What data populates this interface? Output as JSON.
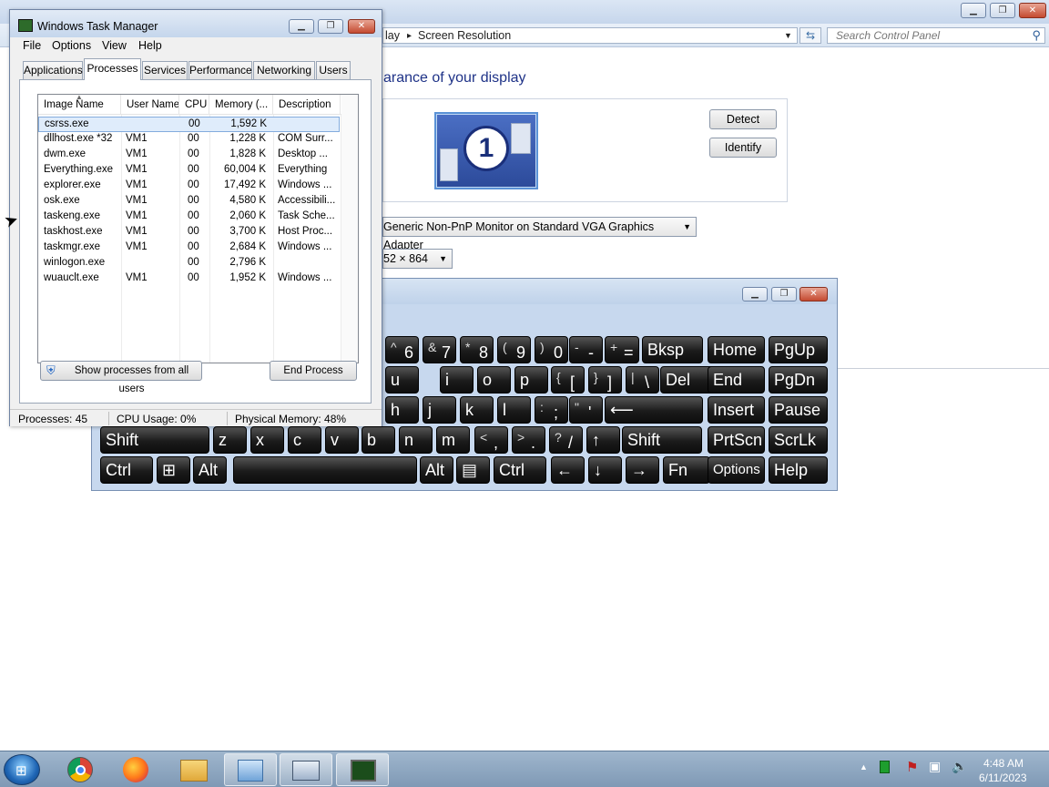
{
  "control_panel": {
    "breadcrumb": [
      "lay",
      "Screen Resolution"
    ],
    "breadcrumb_sep": "▸",
    "search_placeholder": "Search Control Panel",
    "heading": "arance of your display",
    "detect_label": "Detect",
    "identify_label": "Identify",
    "monitor_number": "1",
    "display_value": "Generic Non-PnP Monitor on Standard VGA Graphics Adapter",
    "resolution_value": "52 × 864"
  },
  "task_manager": {
    "title": "Windows Task Manager",
    "menu": [
      "File",
      "Options",
      "View",
      "Help"
    ],
    "tabs": [
      "Applications",
      "Processes",
      "Services",
      "Performance",
      "Networking",
      "Users"
    ],
    "active_tab": "Processes",
    "columns": [
      "Image Name",
      "User Name",
      "CPU",
      "Memory (...",
      "Description"
    ],
    "rows": [
      {
        "image": "csrss.exe",
        "user": "",
        "cpu": "00",
        "memory": "1,592 K",
        "description": ""
      },
      {
        "image": "dllhost.exe *32",
        "user": "VM1",
        "cpu": "00",
        "memory": "1,228 K",
        "description": "COM Surr..."
      },
      {
        "image": "dwm.exe",
        "user": "VM1",
        "cpu": "00",
        "memory": "1,828 K",
        "description": "Desktop ..."
      },
      {
        "image": "Everything.exe",
        "user": "VM1",
        "cpu": "00",
        "memory": "60,004 K",
        "description": "Everything"
      },
      {
        "image": "explorer.exe",
        "user": "VM1",
        "cpu": "00",
        "memory": "17,492 K",
        "description": "Windows ..."
      },
      {
        "image": "osk.exe",
        "user": "VM1",
        "cpu": "00",
        "memory": "4,580 K",
        "description": "Accessibili..."
      },
      {
        "image": "taskeng.exe",
        "user": "VM1",
        "cpu": "00",
        "memory": "2,060 K",
        "description": "Task Sche..."
      },
      {
        "image": "taskhost.exe",
        "user": "VM1",
        "cpu": "00",
        "memory": "3,700 K",
        "description": "Host Proc..."
      },
      {
        "image": "taskmgr.exe",
        "user": "VM1",
        "cpu": "00",
        "memory": "2,684 K",
        "description": "Windows ..."
      },
      {
        "image": "winlogon.exe",
        "user": "",
        "cpu": "00",
        "memory": "2,796 K",
        "description": ""
      },
      {
        "image": "wuauclt.exe",
        "user": "VM1",
        "cpu": "00",
        "memory": "1,952 K",
        "description": "Windows ..."
      }
    ],
    "show_all_label": "Show processes from all users",
    "end_process_label": "End Process",
    "status": {
      "processes": "Processes: 45",
      "cpu": "CPU Usage: 0%",
      "memory": "Physical Memory: 48%"
    }
  },
  "keyboard": {
    "rows": [
      [
        {
          "sup": "^",
          "main": "6"
        },
        {
          "sup": "&",
          "main": "7"
        },
        {
          "sup": "*",
          "main": "8"
        },
        {
          "sup": "(",
          "main": "9"
        },
        {
          "sup": ")",
          "main": "0"
        },
        {
          "sup": "-",
          "main": "-"
        },
        {
          "sup": "+",
          "main": "="
        },
        {
          "label": "Bksp"
        },
        {
          "label": "Home"
        },
        {
          "label": "PgUp"
        }
      ],
      [
        {
          "label": "u"
        },
        {
          "label": "i"
        },
        {
          "label": "o"
        },
        {
          "label": "p"
        },
        {
          "sup": "{",
          "main": "["
        },
        {
          "sup": "}",
          "main": "]"
        },
        {
          "sup": "|",
          "main": "\\"
        },
        {
          "label": "Del"
        },
        {
          "label": "End"
        },
        {
          "label": "PgDn"
        }
      ],
      [
        {
          "label": "h"
        },
        {
          "label": "j"
        },
        {
          "label": "k"
        },
        {
          "label": "l"
        },
        {
          "sup": ":",
          "main": ";"
        },
        {
          "sup": "\"",
          "main": "'"
        },
        {
          "label": "⟵"
        },
        {
          "label": "Insert"
        },
        {
          "label": "Pause"
        }
      ],
      [
        {
          "label": "Shift"
        },
        {
          "label": "z"
        },
        {
          "label": "x"
        },
        {
          "label": "c"
        },
        {
          "label": "v"
        },
        {
          "label": "b"
        },
        {
          "label": "n"
        },
        {
          "label": "m"
        },
        {
          "sup": "<",
          "main": ","
        },
        {
          "sup": ">",
          "main": "."
        },
        {
          "sup": "?",
          "main": "/"
        },
        {
          "label": "↑"
        },
        {
          "label": "Shift"
        },
        {
          "label": "PrtScn"
        },
        {
          "label": "ScrLk"
        }
      ],
      [
        {
          "label": "Ctrl"
        },
        {
          "label": "⊞"
        },
        {
          "label": "Alt"
        },
        {
          "label": ""
        },
        {
          "label": "Alt"
        },
        {
          "label": "▤"
        },
        {
          "label": "Ctrl"
        },
        {
          "label": "←"
        },
        {
          "label": "↓"
        },
        {
          "label": "→"
        },
        {
          "label": "Fn"
        },
        {
          "label": "Options"
        },
        {
          "label": "Help"
        }
      ]
    ]
  },
  "taskbar": {
    "time": "4:48 AM",
    "date": "6/11/2023",
    "apps": [
      "chrome-icon",
      "firefox-icon",
      "file-explorer-icon",
      "control-panel-icon",
      "on-screen-keyboard-icon",
      "task-manager-icon"
    ]
  }
}
